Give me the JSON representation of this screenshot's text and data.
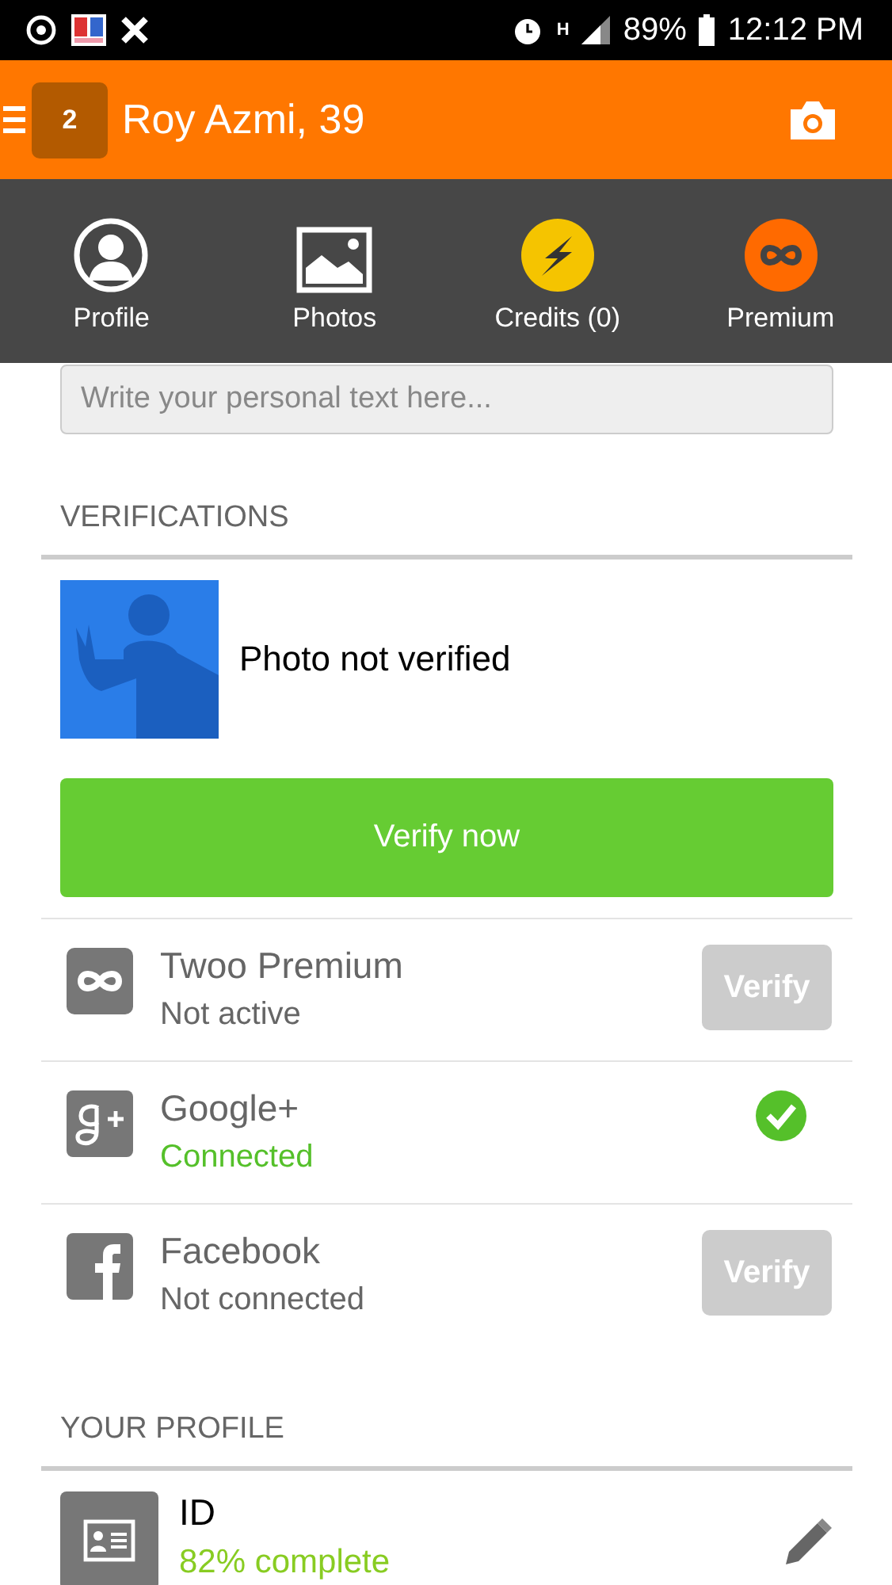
{
  "status_bar": {
    "network": "H",
    "battery": "89%",
    "time": "12:12 PM"
  },
  "header": {
    "badge": "2",
    "title": "Roy Azmi, 39"
  },
  "menu": [
    {
      "kind": "profile",
      "label": "Profile"
    },
    {
      "kind": "photos",
      "label": "Photos"
    },
    {
      "kind": "credits",
      "label": "Credits (0)"
    },
    {
      "kind": "premium",
      "label": "Premium"
    }
  ],
  "intro": {
    "placeholder": "Write your personal text here..."
  },
  "verifications": {
    "title": "VERIFICATIONS",
    "photo_status": "Photo not verified",
    "button": "Verify now",
    "accounts": [
      {
        "kind": "premium",
        "name": "Twoo Premium",
        "status": "Not active",
        "connected": false,
        "action": "Verify"
      },
      {
        "kind": "google",
        "name": "Google+",
        "status": "Connected",
        "connected": true
      },
      {
        "kind": "facebook",
        "name": "Facebook",
        "status": "Not connected",
        "connected": false,
        "action": "Verify"
      }
    ]
  },
  "profile": {
    "title": "YOUR PROFILE",
    "items": [
      {
        "kind": "id",
        "name": "ID",
        "progress": "82% complete"
      }
    ]
  }
}
